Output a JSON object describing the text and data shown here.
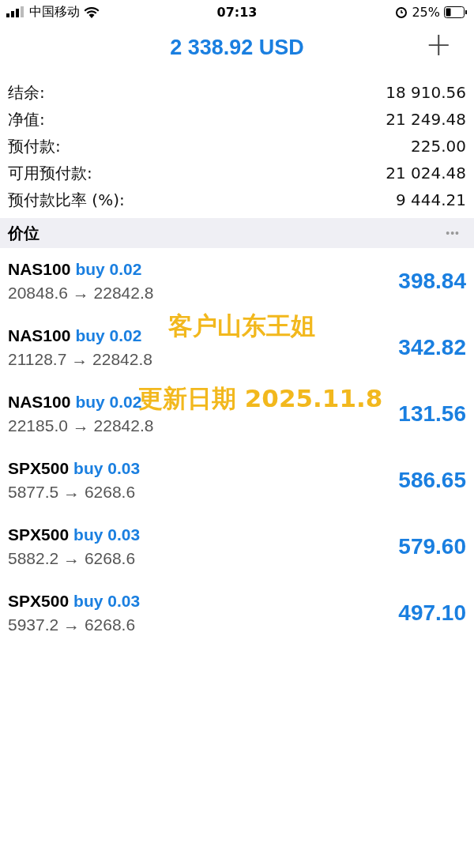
{
  "status_bar": {
    "carrier": "中国移动",
    "time": "07:13",
    "battery": "25%"
  },
  "header": {
    "title": "2 338.92 USD",
    "add": "+"
  },
  "account": [
    {
      "label": "结余:",
      "value": "18 910.56"
    },
    {
      "label": "净值:",
      "value": "21 249.48"
    },
    {
      "label": "预付款:",
      "value": "225.00"
    },
    {
      "label": "可用预付款:",
      "value": "21 024.48"
    },
    {
      "label": "预付款比率 (%):",
      "value": "9 444.21"
    }
  ],
  "section": {
    "title": "价位",
    "more": "•••"
  },
  "positions": [
    {
      "symbol": "NAS100",
      "side": "buy 0.02",
      "prices": "20848.6 → 22842.8",
      "profit": "398.84"
    },
    {
      "symbol": "NAS100",
      "side": "buy 0.02",
      "prices": "21128.7 → 22842.8",
      "profit": "342.82"
    },
    {
      "symbol": "NAS100",
      "side": "buy 0.02",
      "prices": "22185.0 → 22842.8",
      "profit": "131.56"
    },
    {
      "symbol": "SPX500",
      "side": "buy 0.03",
      "prices": "5877.5 → 6268.6",
      "profit": "586.65"
    },
    {
      "symbol": "SPX500",
      "side": "buy 0.03",
      "prices": "5882.2 → 6268.6",
      "profit": "579.60"
    },
    {
      "symbol": "SPX500",
      "side": "buy 0.03",
      "prices": "5937.2 → 6268.6",
      "profit": "497.10"
    }
  ],
  "overlay": [
    "客户山东王姐",
    "更新日期 2025.11.8"
  ]
}
